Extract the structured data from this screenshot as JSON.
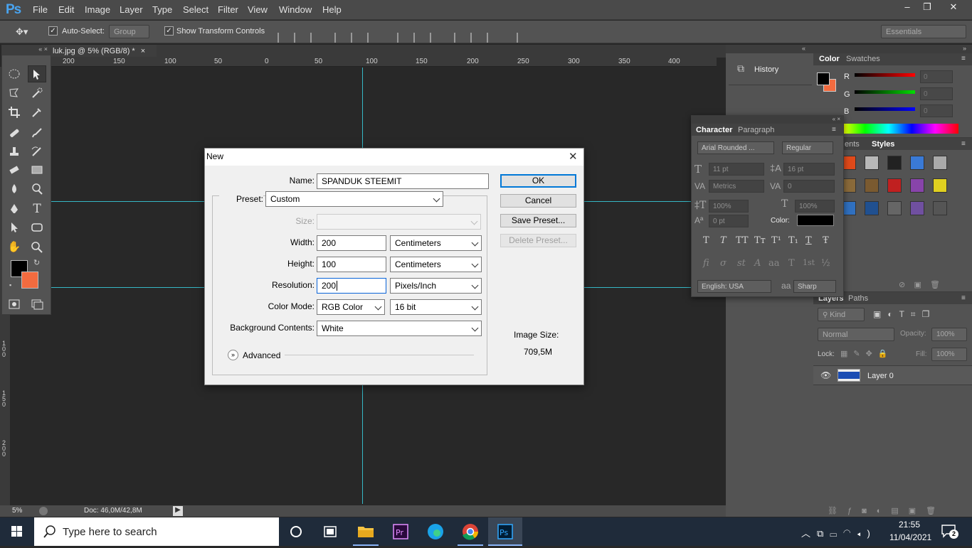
{
  "app": {
    "logo": "Ps"
  },
  "menubar": {
    "items": [
      "File",
      "Edit",
      "Image",
      "Layer",
      "Type",
      "Select",
      "Filter",
      "View",
      "Window",
      "Help"
    ]
  },
  "window_controls": {
    "minimize": "‒",
    "restore": "❐",
    "close": "✕"
  },
  "options": {
    "auto_select_label": "Auto-Select:",
    "auto_select_value": "Group",
    "show_transform_label": "Show Transform Controls",
    "workspace": "Essentials"
  },
  "document": {
    "tab_title": "luk.jpg @ 5% (RGB/8) *",
    "ruler_top": [
      "200",
      "150",
      "100",
      "50",
      "0",
      "50",
      "100",
      "150",
      "200",
      "250",
      "300",
      "350",
      "400"
    ],
    "ruler_left": [
      "1 0 0",
      "1 5 0",
      "2 0 0"
    ],
    "zoom": "5%",
    "doc_size": "Doc: 46,0M/42,8M"
  },
  "panels": {
    "history_label": "History",
    "color_tabs": [
      "Color",
      "Swatches"
    ],
    "color_channels": [
      {
        "label": "R",
        "value": "0"
      },
      {
        "label": "G",
        "value": "0"
      },
      {
        "label": "B",
        "value": "0"
      }
    ],
    "styles_tabs": [
      "ents",
      "Styles"
    ],
    "character": {
      "tabs": [
        "Character",
        "Paragraph"
      ],
      "font_family": "Arial Rounded ...",
      "font_style": "Regular",
      "size": "11 pt",
      "leading": "16 pt",
      "kerning": "Metrics",
      "tracking": "0",
      "vscale": "100%",
      "hscale": "100%",
      "baseline": "0 pt",
      "color_label": "Color:",
      "language": "English: USA",
      "antialias": "Sharp",
      "aa_label": "a",
      "type_buttons": [
        "T",
        "T",
        "TT",
        "Tт",
        "T¹",
        "T₁",
        "T",
        "Ŧ"
      ],
      "ot_buttons": [
        "fi",
        "σ",
        "st",
        "A",
        "aa",
        "T",
        "1st",
        "½"
      ],
      "color": "#000000"
    },
    "layers": {
      "tabs": [
        "Layers",
        "Paths"
      ],
      "kind": "Kind",
      "blend": "Normal",
      "opacity_label": "Opacity:",
      "opacity": "100%",
      "lock_label": "Lock:",
      "fill_label": "Fill:",
      "fill": "100%",
      "layer_name": "Layer 0"
    }
  },
  "dialog": {
    "title": "New",
    "name_label": "Name:",
    "name_value": "SPANDUK STEEMIT",
    "preset_label": "Preset:",
    "preset_value": "Custom",
    "size_label": "Size:",
    "width_label": "Width:",
    "width_value": "200",
    "width_unit": "Centimeters",
    "height_label": "Height:",
    "height_value": "100",
    "height_unit": "Centimeters",
    "resolution_label": "Resolution:",
    "resolution_value": "200",
    "resolution_unit": "Pixels/Inch",
    "color_mode_label": "Color Mode:",
    "color_mode_value": "RGB Color",
    "bit_depth": "16 bit",
    "background_label": "Background Contents:",
    "background_value": "White",
    "advanced_label": "Advanced",
    "ok": "OK",
    "cancel": "Cancel",
    "save_preset": "Save Preset...",
    "delete_preset": "Delete Preset...",
    "image_size_label": "Image Size:",
    "image_size_value": "709,5M"
  },
  "taskbar": {
    "search_placeholder": "Type here to search",
    "time": "21:55",
    "date": "11/04/2021",
    "notification_count": "2",
    "apps": [
      "task-view",
      "file-explorer",
      "premiere",
      "edge",
      "chrome",
      "photoshop"
    ]
  },
  "colors": {
    "foreground": "#000000",
    "background": "#f26b3f",
    "guide": "#36b8c6",
    "ps_blue": "#49a4f0"
  }
}
